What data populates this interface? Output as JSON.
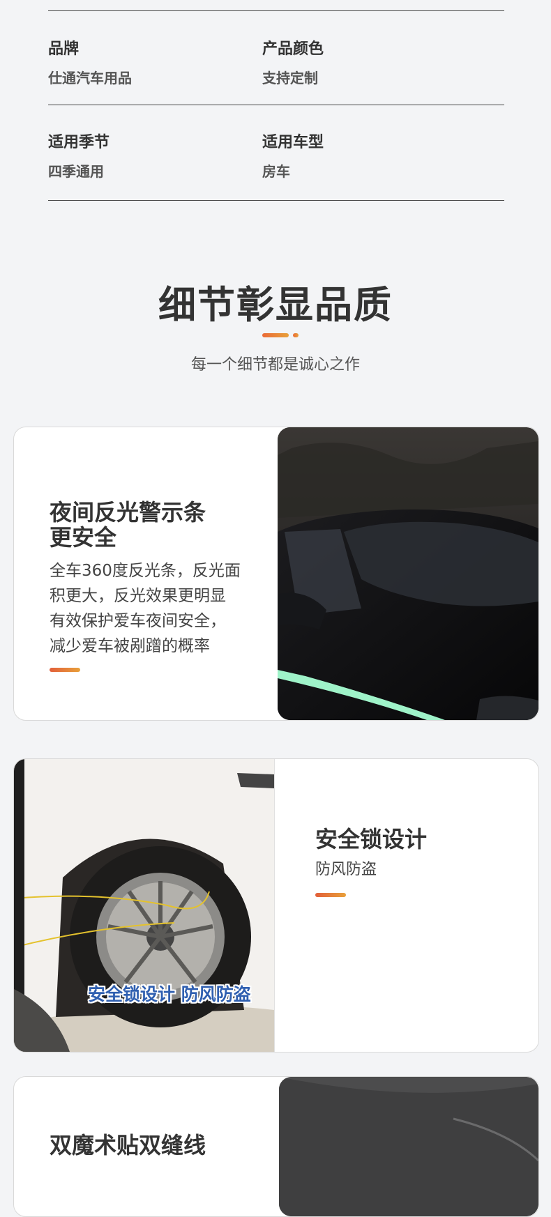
{
  "specs": [
    {
      "label": "品牌",
      "value": "仕通汽车用品"
    },
    {
      "label": "产品颜色",
      "value": "支持定制"
    },
    {
      "label": "适用季节",
      "value": "四季通用"
    },
    {
      "label": "适用车型",
      "value": "房车"
    }
  ],
  "section": {
    "title": "细节彰显品质",
    "subtitle": "每一个细节都是诚心之作"
  },
  "features": [
    {
      "title_line1": "夜间反光警示条",
      "title_line2": "更安全",
      "desc_lines": [
        "全车360度反光条，反光面",
        "积更大，反光效果更明显",
        "有效保护爱车夜间安全，",
        "减少爱车被剐蹭的概率"
      ]
    },
    {
      "title_line1": "安全锁设计",
      "subtitle": "防风防盗",
      "image_caption": "安全锁设计 防风防盗"
    },
    {
      "title_line1": "双魔术贴双缝线"
    }
  ],
  "colors": {
    "accent_start": "#ea6a37",
    "accent_end": "#e8a03a",
    "reflective_strip": "#9ff3c9"
  }
}
